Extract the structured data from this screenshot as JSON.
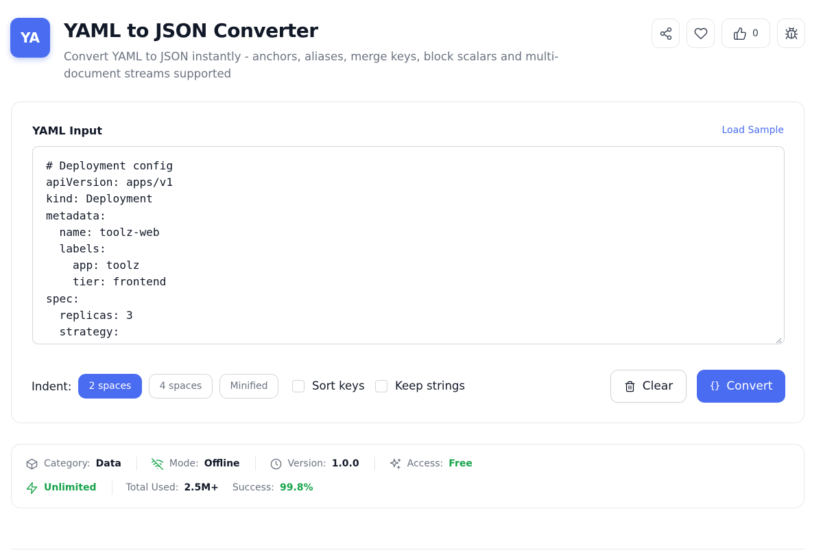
{
  "header": {
    "logo_text": "YA",
    "title": "YAML to JSON Converter",
    "subtitle": "Convert YAML to JSON instantly - anchors, aliases, merge keys, block scalars and multi-document streams supported",
    "like_count": "0",
    "actions": [
      {
        "name": "share",
        "icon": "share-icon"
      },
      {
        "name": "favorite",
        "icon": "heart-icon"
      },
      {
        "name": "like",
        "icon": "thumbs-up-icon"
      },
      {
        "name": "report-bug",
        "icon": "bug-icon"
      }
    ]
  },
  "editor": {
    "label": "YAML Input",
    "load_sample_label": "Load Sample",
    "value": "# Deployment config\napiVersion: apps/v1\nkind: Deployment\nmetadata:\n  name: toolz-web\n  labels:\n    app: toolz\n    tier: frontend\nspec:\n  replicas: 3\n  strategy:\n    type: RollingUpdate"
  },
  "options": {
    "indent_label": "Indent:",
    "indent_options": [
      "2 spaces",
      "4 spaces",
      "Minified"
    ],
    "selected_indent": "2 spaces",
    "sort_keys_label": "Sort keys",
    "sort_keys_checked": false,
    "keep_strings_label": "Keep strings",
    "keep_strings_checked": false
  },
  "actions": {
    "clear_label": "Clear",
    "convert_label": "Convert",
    "convert_icon_text": "{}"
  },
  "meta": {
    "category_key": "Category:",
    "category_val": "Data",
    "mode_key": "Mode:",
    "mode_val": "Offline",
    "version_key": "Version:",
    "version_val": "1.0.0",
    "access_key": "Access:",
    "access_val": "Free",
    "unlimited": "Unlimited",
    "total_used_key": "Total Used:",
    "total_used_val": "2.5M+",
    "success_key": "Success:",
    "success_val": "99.8%"
  },
  "colors": {
    "accent": "#4a6cf0",
    "success": "#16a34a",
    "muted": "#6b7280",
    "border": "#e5e7eb"
  }
}
